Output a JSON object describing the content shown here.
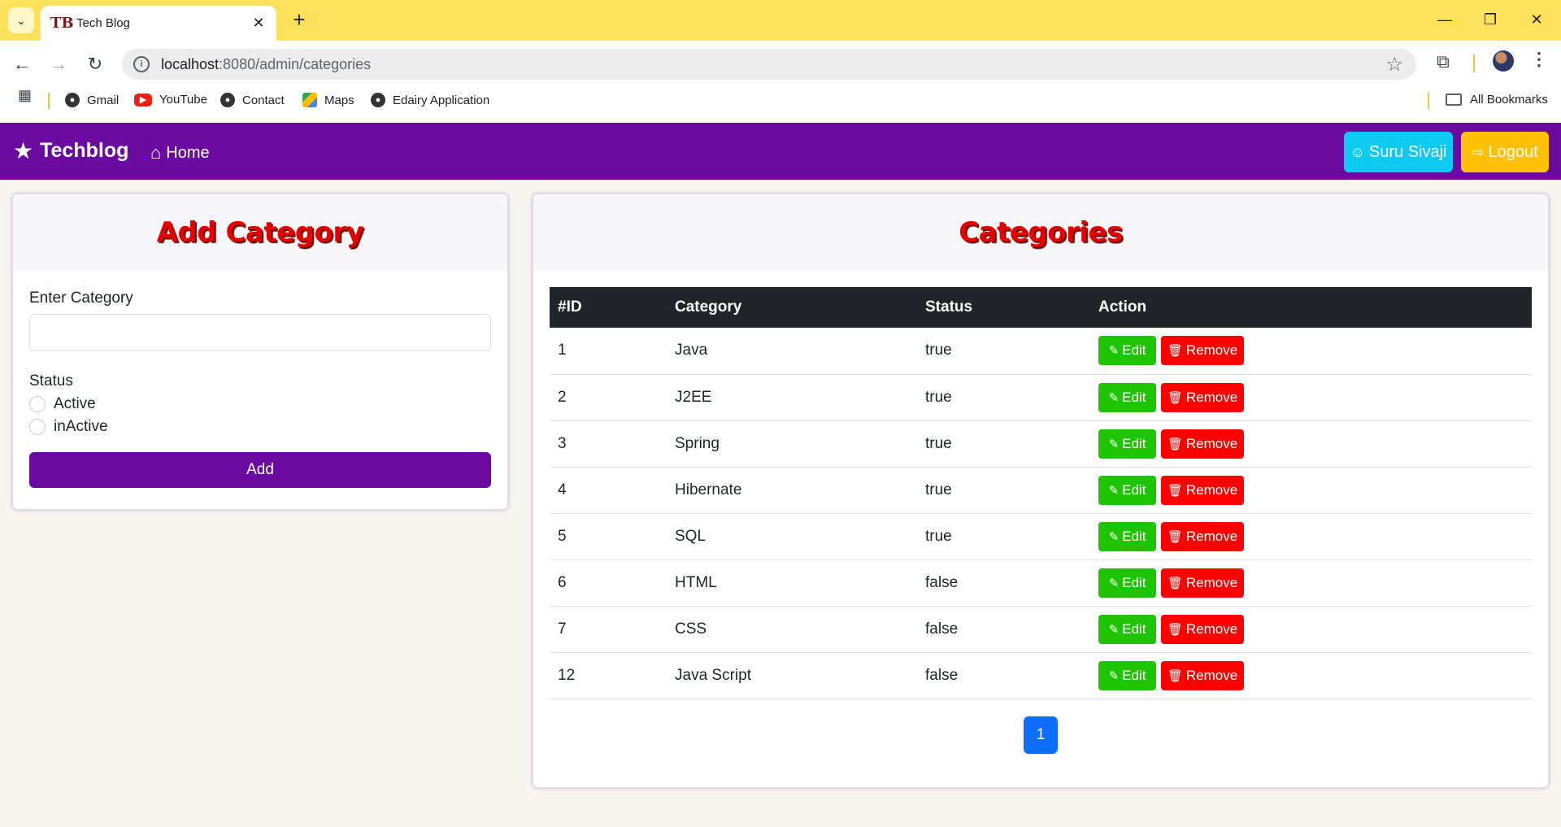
{
  "browser": {
    "tab_title": "Tech Blog",
    "tab_logo": "TB",
    "url_host": "localhost",
    "url_path": ":8080/admin/categories",
    "bookmarks": [
      {
        "label": "Gmail",
        "icon": "globe-icon"
      },
      {
        "label": "YouTube",
        "icon": "youtube-icon"
      },
      {
        "label": "Contact",
        "icon": "globe-icon"
      },
      {
        "label": "Maps",
        "icon": "maps-icon"
      },
      {
        "label": "Edairy Application",
        "icon": "globe-icon"
      }
    ],
    "all_bookmarks": "All Bookmarks"
  },
  "navbar": {
    "brand": "Techblog",
    "home": "Home",
    "user": "Suru Sivaji",
    "logout": "Logout",
    "color": "#6a0aa0"
  },
  "add_category": {
    "title": "Add Category",
    "field_label": "Enter Category",
    "field_value": "",
    "status_label": "Status",
    "options": [
      "Active",
      "inActive"
    ],
    "submit": "Add"
  },
  "categories": {
    "title": "Categories",
    "columns": [
      "#ID",
      "Category",
      "Status",
      "Action"
    ],
    "edit_label": "Edit",
    "remove_label": "Remove",
    "rows": [
      {
        "id": "1",
        "name": "Java",
        "status": "true"
      },
      {
        "id": "2",
        "name": "J2EE",
        "status": "true"
      },
      {
        "id": "3",
        "name": "Spring",
        "status": "true"
      },
      {
        "id": "4",
        "name": "Hibernate",
        "status": "true"
      },
      {
        "id": "5",
        "name": "SQL",
        "status": "true"
      },
      {
        "id": "6",
        "name": "HTML",
        "status": "false"
      },
      {
        "id": "7",
        "name": "CSS",
        "status": "false"
      },
      {
        "id": "12",
        "name": "Java Script",
        "status": "false"
      }
    ],
    "page": "1"
  }
}
